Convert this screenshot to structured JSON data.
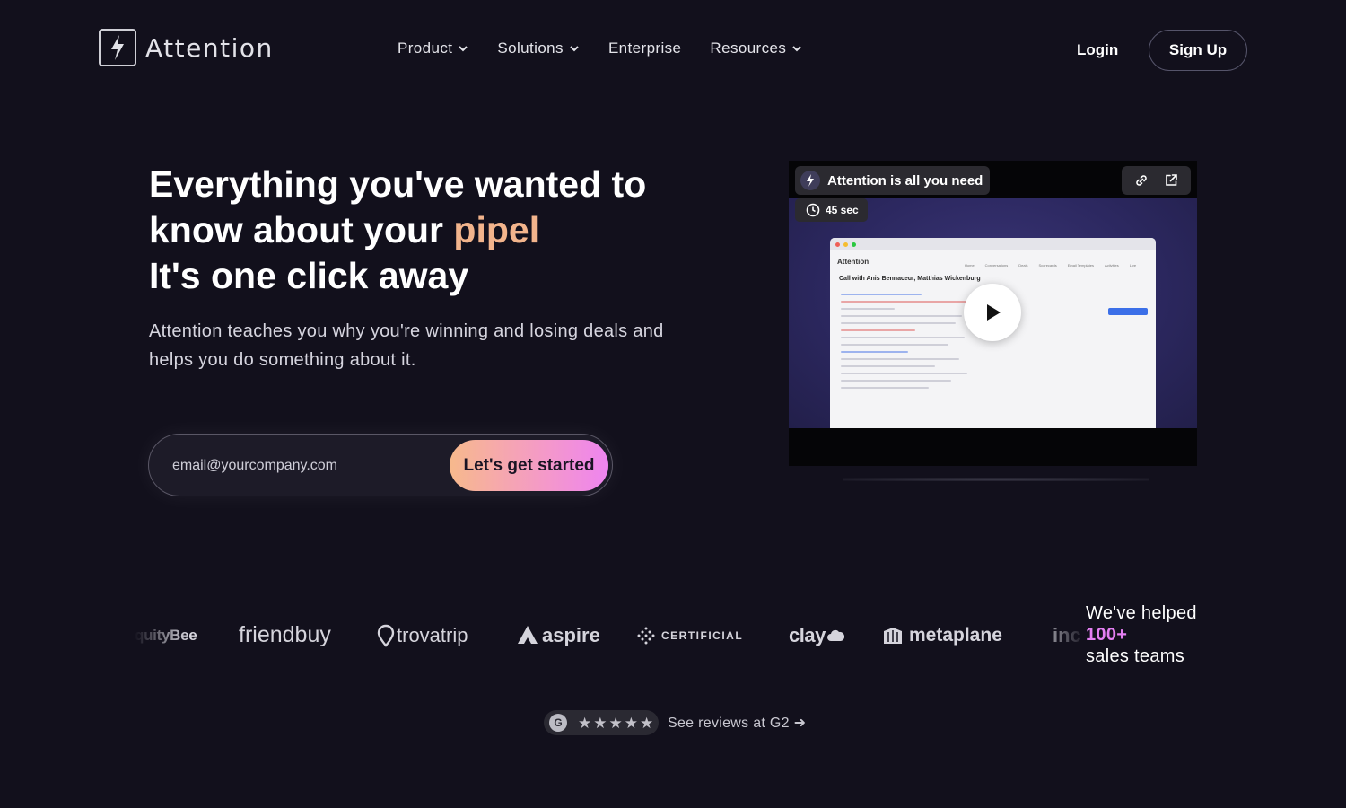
{
  "brand": {
    "name": "Attention"
  },
  "nav": {
    "items": [
      {
        "label": "Product",
        "dropdown": true
      },
      {
        "label": "Solutions",
        "dropdown": true
      },
      {
        "label": "Enterprise",
        "dropdown": false
      },
      {
        "label": "Resources",
        "dropdown": true
      }
    ],
    "login": "Login",
    "signup": "Sign Up"
  },
  "hero": {
    "title_line1": "Everything you've wanted to",
    "title_line2_start": "know about your ",
    "title_line2_accent": "pipel",
    "title_line3": "It's one click away",
    "subtitle": "Attention teaches you why you're winning and losing deals and helps you do something about it.",
    "email_placeholder": "email@yourcompany.com",
    "cta": "Let's get started"
  },
  "video": {
    "title": "Attention is all you need",
    "duration": "45 sec",
    "app": {
      "logo": "Attention",
      "heading": "Call with Anis Bennaceur, Matthias Wickenburg",
      "nav": [
        "Home",
        "Conversations",
        "Deals",
        "Scorecards",
        "Email Templates",
        "Activities",
        "Live"
      ]
    }
  },
  "logos": {
    "brands": [
      "quityBee",
      "friendbuy",
      "trovatrip",
      "aspire",
      "CERTIFICIAL",
      "clay",
      "metaplane",
      "inc"
    ],
    "helped_line1": "We've helped",
    "helped_count": "100+",
    "helped_line3": "sales teams"
  },
  "reviews": {
    "badge": "G",
    "stars": 5,
    "link": "See reviews at G2 ➜"
  },
  "colors": {
    "background": "#12101c",
    "accent_text": "#f2b48c",
    "cta_gradient_start": "#f7b98c",
    "cta_gradient_end": "#ee84f0",
    "helped_count": "#e47ff2"
  }
}
